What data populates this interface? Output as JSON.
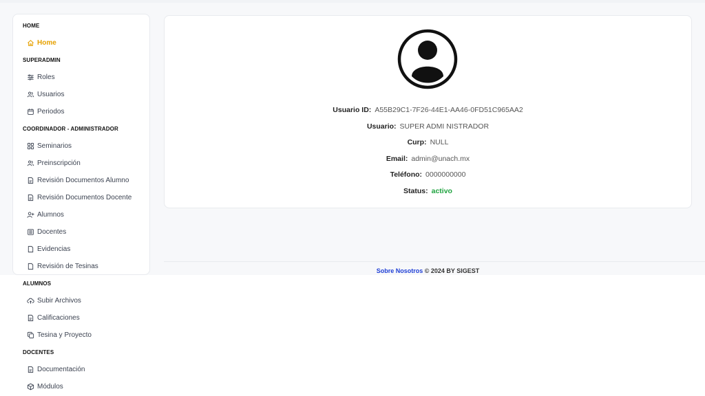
{
  "sidebar": {
    "sections": {
      "home": "HOME",
      "superadmin": "SUPERADMIN",
      "coordinador": "COORDINADOR - ADMINISTRADOR",
      "alumnos": "ALUMNOS",
      "docentes": "DOCENTES"
    },
    "items": {
      "home": "Home",
      "roles": "Roles",
      "usuarios": "Usuarios",
      "periodos": "Periodos",
      "seminarios": "Seminarios",
      "preinscripcion": "Preinscripción",
      "revision_alumno": "Revisión Documentos Alumno",
      "revision_docente": "Revisión Documentos Docente",
      "alumnos": "Alumnos",
      "docentes": "Docentes",
      "evidencias": "Evidencias",
      "revision_tesinas": "Revisión de Tesinas",
      "subir_archivos": "Subir Archivos",
      "calificaciones": "Calificaciones",
      "tesina_proyecto": "Tesina y Proyecto",
      "documentacion": "Documentación",
      "modulos": "Módulos"
    }
  },
  "profile": {
    "id_label": "Usuario ID:",
    "id_value": "A55B29C1-7F26-44E1-AA46-0FD51C965AA2",
    "user_label": "Usuario:",
    "user_value": "SUPER ADMI NISTRADOR",
    "curp_label": "Curp:",
    "curp_value": "NULL",
    "email_label": "Email:",
    "email_value": "admin@unach.mx",
    "phone_label": "Teléfono:",
    "phone_value": "0000000000",
    "status_label": "Status:",
    "status_value": "activo"
  },
  "footer": {
    "link": "Sobre Nosotros",
    "text": " © 2024 BY SIGEST"
  },
  "colors": {
    "active": "#e6a100",
    "status": "#1fa33f",
    "link": "#1f3fd6"
  }
}
